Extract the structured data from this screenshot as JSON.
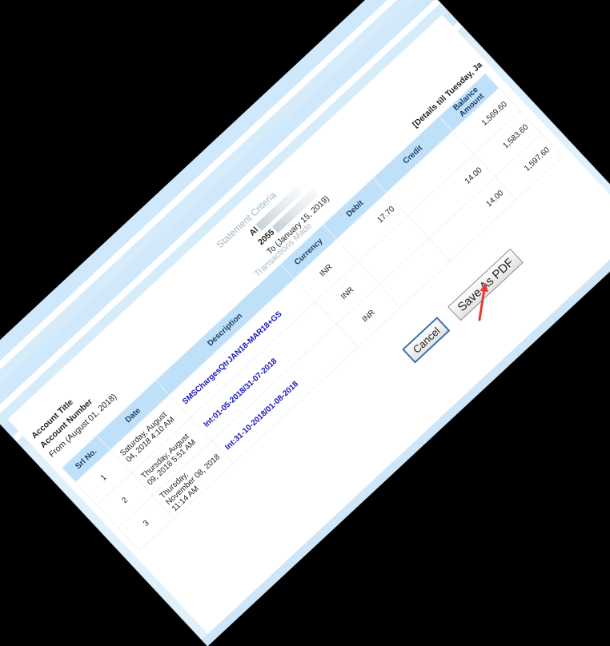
{
  "criteria": {
    "title": "Statement Criteria",
    "account_title_label": "Account Title",
    "account_number_label": "Account Number",
    "from_text": "From (August 01, 2018)",
    "account_title_value": "Al",
    "account_number_value": "2055",
    "to_text": "To (January 15, 2019)",
    "details_text": "[Details till Tuesday, Ja"
  },
  "transactions": {
    "title": "Transactions Made",
    "columns": [
      "Srl No.",
      "Date",
      "Description",
      "Currency",
      "Debit",
      "Credit",
      "Balance Amount"
    ],
    "rows": [
      {
        "srl": "1",
        "date": "Saturday, August 04, 2018 4:10 AM",
        "description": "SMSChargesQtrJAN18-MAR18+GS",
        "currency": "INR",
        "debit": "17.70",
        "credit": "",
        "balance": "1,569.60"
      },
      {
        "srl": "2",
        "date": "Thursday, August 09, 2018 5:51 AM",
        "description": "Int:01-05-2018/31-07-2018",
        "currency": "INR",
        "debit": "",
        "credit": "14.00",
        "balance": "1,583.60"
      },
      {
        "srl": "3",
        "date": "Thursday, November 08, 2018 11:14 AM",
        "description": "Int:31-10-2018/01-08-2018",
        "currency": "INR",
        "debit": "",
        "credit": "14.00",
        "balance": "1,597.60"
      }
    ]
  },
  "buttons": {
    "cancel_label": "Cancel",
    "save_pdf_label": "Save As PDF"
  },
  "colors": {
    "header_bg": "#bfe0f9",
    "link": "#1515b8",
    "annotation_arrow": "#e53935",
    "panel_bg": "#e1f1fc"
  }
}
